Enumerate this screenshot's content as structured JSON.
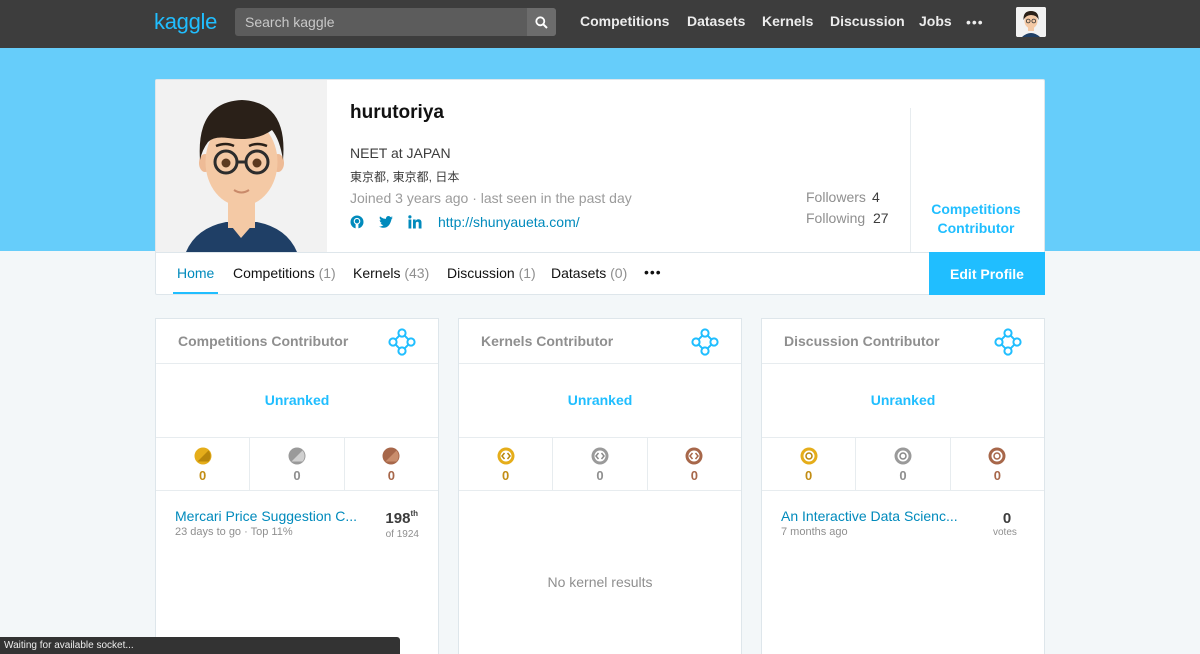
{
  "nav": {
    "logo": "kaggle",
    "search_placeholder": "Search kaggle",
    "links": [
      "Competitions",
      "Datasets",
      "Kernels",
      "Discussion",
      "Jobs"
    ],
    "more": "•••"
  },
  "profile": {
    "username": "hurutoriya",
    "occupation": "NEET at JAPAN",
    "location": "東京都, 東京都, 日本",
    "joined": "Joined 3 years ago · last seen in the past day",
    "website": "http://shunyaueta.com/",
    "followers_label": "Followers",
    "followers_count": "4",
    "following_label": "Following",
    "following_count": "27",
    "tier_line1": "Competitions",
    "tier_line2": "Contributor"
  },
  "tabs": [
    {
      "label": "Home",
      "count": ""
    },
    {
      "label": "Competitions",
      "count": "(1)"
    },
    {
      "label": "Kernels",
      "count": "(43)"
    },
    {
      "label": "Discussion",
      "count": "(1)"
    },
    {
      "label": "Datasets",
      "count": "(0)"
    }
  ],
  "tabs_more": "•••",
  "edit_profile": "Edit Profile",
  "cards": [
    {
      "title": "Competitions Contributor",
      "rank": "Unranked",
      "medals": [
        "0",
        "0",
        "0"
      ],
      "item_title": "Mercari Price Suggestion C...",
      "item_sub": "23 days to go · Top 11%",
      "item_rank": "198",
      "item_rank_suffix": "th",
      "item_rank_sub": "of 1924"
    },
    {
      "title": "Kernels Contributor",
      "rank": "Unranked",
      "medals": [
        "0",
        "0",
        "0"
      ],
      "empty": "No kernel results"
    },
    {
      "title": "Discussion Contributor",
      "rank": "Unranked",
      "medals": [
        "0",
        "0",
        "0"
      ],
      "item_title": "An Interactive Data Scienc...",
      "item_sub": "7 months ago",
      "votes": "0",
      "votes_label": "votes"
    }
  ],
  "status": "Waiting for available socket...",
  "colors": {
    "brand": "#20beff",
    "banner": "#66cdfa",
    "link": "#008abc",
    "gold": "#c28d15",
    "silver": "#8f8f8f",
    "bronze": "#a7674a"
  }
}
